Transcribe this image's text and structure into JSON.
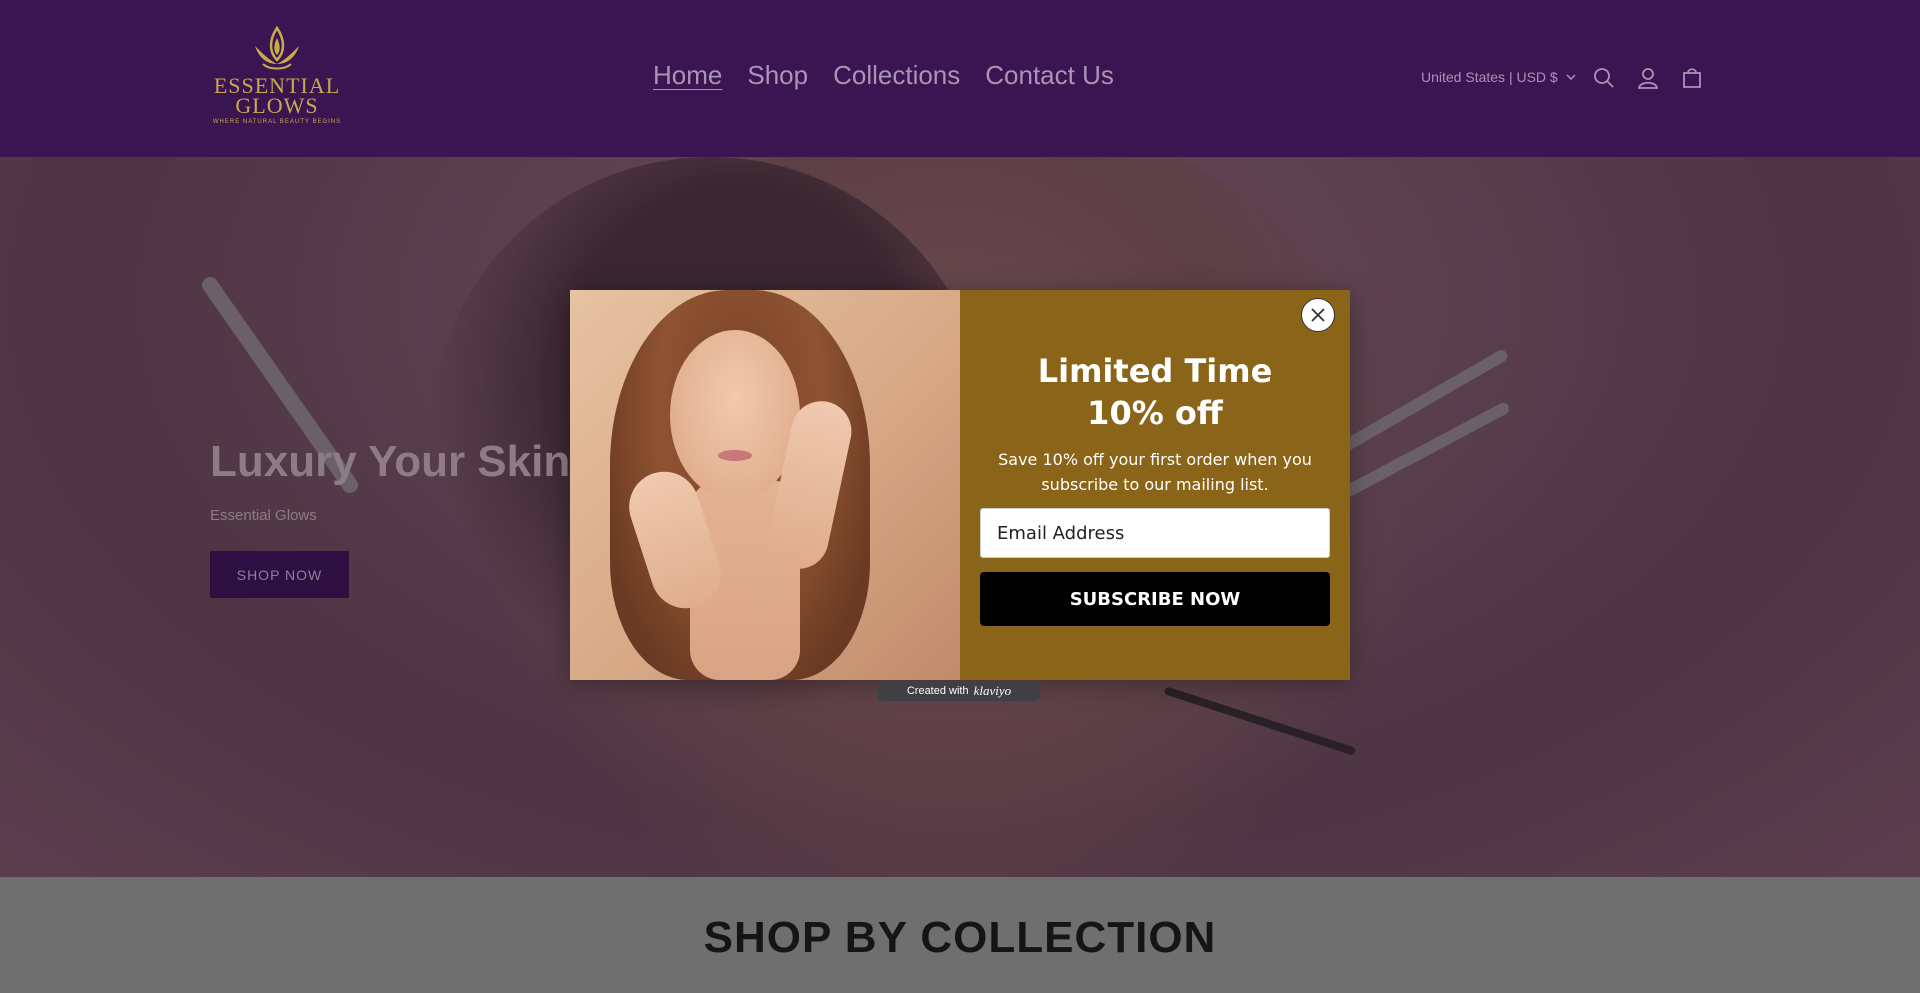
{
  "header": {
    "logo": {
      "name_line1": "ESSENTIAL",
      "name_line2": "GLOWS",
      "tagline": "WHERE NATURAL BEAUTY BEGINS"
    },
    "nav": [
      {
        "label": "Home",
        "active": true
      },
      {
        "label": "Shop"
      },
      {
        "label": "Collections"
      },
      {
        "label": "Contact Us"
      }
    ],
    "currency": "United States | USD $",
    "icons": [
      "search-icon",
      "account-icon",
      "cart-icon"
    ]
  },
  "hero": {
    "title": "Luxury Your Skin De",
    "subtitle": "Essential Glows",
    "button": "SHOP NOW"
  },
  "collection": {
    "title": "SHOP BY COLLECTION"
  },
  "popup": {
    "heading_line1": "Limited Time",
    "heading_line2": "10% off",
    "text": "Save 10% off your first order when you subscribe to our mailing list.",
    "email_placeholder": "Email Address",
    "button": "SUBSCRIBE NOW",
    "footer_prefix": "Created with",
    "footer_brand": "klaviyo"
  },
  "colors": {
    "header_bg": "#3b1452",
    "popup_bg": "#8a6419",
    "logo_gold": "#c9a94e"
  }
}
